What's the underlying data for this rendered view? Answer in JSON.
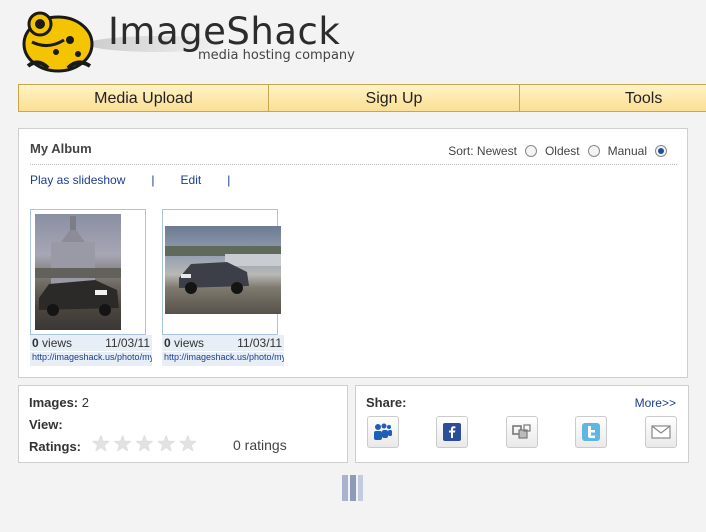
{
  "header": {
    "title": "ImageShack",
    "subtitle": "media hosting company"
  },
  "nav": {
    "items": [
      {
        "label": "Media Upload"
      },
      {
        "label": "Sign Up"
      },
      {
        "label": "Tools"
      }
    ]
  },
  "album": {
    "title": "My Album",
    "sort": {
      "label": "Sort: Newest",
      "options": [
        "Oldest",
        "Manual"
      ],
      "selected": "Manual"
    },
    "links": {
      "slideshow": "Play as slideshow",
      "edit": "Edit",
      "separator": "|"
    },
    "images": [
      {
        "views_count": "0",
        "views_label": "views",
        "date": "11/03/11",
        "url": "http://imageshack.us/photo/my-images/"
      },
      {
        "views_count": "0",
        "views_label": "views",
        "date": "11/03/11",
        "url": "http://imageshack.us/photo/my-images/"
      }
    ]
  },
  "stats": {
    "images_label": "Images:",
    "images_value": "2",
    "view_label": "View:",
    "ratings_label": "Ratings:",
    "ratings_count": "0 ratings",
    "stars_total": 5,
    "stars_filled": 0
  },
  "share": {
    "title": "Share:",
    "more": "More>>",
    "icons": [
      "myspace-icon",
      "facebook-icon",
      "digg-icon",
      "twitter-icon",
      "email-icon"
    ]
  },
  "colors": {
    "nav_bg": "#fbdf93",
    "link": "#1a3d8f",
    "frog": "#f5c400"
  }
}
